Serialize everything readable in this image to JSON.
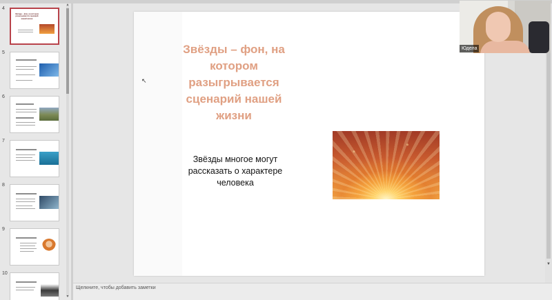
{
  "thumbnails": [
    {
      "number": "4",
      "active": true,
      "title": "Звёзды – фон, на котором разыгрывается сценарий нашей жизни"
    },
    {
      "number": "5",
      "active": false
    },
    {
      "number": "6",
      "active": false
    },
    {
      "number": "7",
      "active": false
    },
    {
      "number": "8",
      "active": false
    },
    {
      "number": "9",
      "active": false
    },
    {
      "number": "10",
      "active": false
    }
  ],
  "slide": {
    "title": "Звёзды – фон, на котором разыгрывается сценарий нашей жизни",
    "body": "Звёзды многое могут рассказать о характере человека",
    "title_color": "#e0a083"
  },
  "notes": {
    "placeholder": "Щелкните, чтобы добавить заметки"
  },
  "webcam": {
    "participant_name": "Юдела"
  },
  "icons": {
    "scroll_up": "scroll-up-icon",
    "scroll_down": "scroll-down-icon",
    "cursor": "mouse-cursor-icon"
  }
}
